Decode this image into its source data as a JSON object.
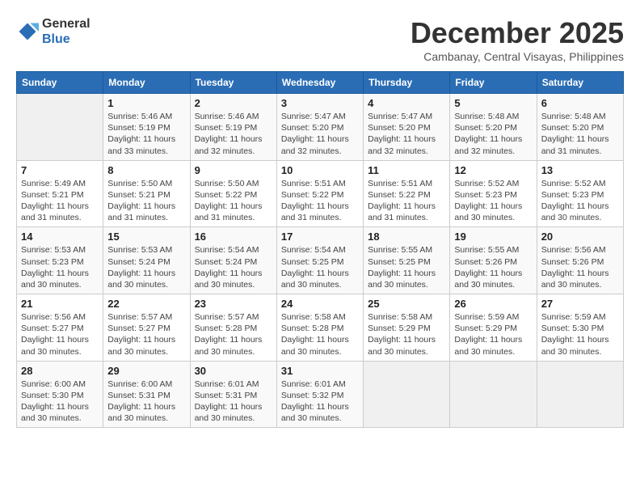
{
  "header": {
    "logo_line1": "General",
    "logo_line2": "Blue",
    "month": "December 2025",
    "location": "Cambanay, Central Visayas, Philippines"
  },
  "weekdays": [
    "Sunday",
    "Monday",
    "Tuesday",
    "Wednesday",
    "Thursday",
    "Friday",
    "Saturday"
  ],
  "weeks": [
    [
      {
        "day": "",
        "empty": true
      },
      {
        "day": "1",
        "sunrise": "5:46 AM",
        "sunset": "5:19 PM",
        "daylight": "11 hours and 33 minutes."
      },
      {
        "day": "2",
        "sunrise": "5:46 AM",
        "sunset": "5:19 PM",
        "daylight": "11 hours and 32 minutes."
      },
      {
        "day": "3",
        "sunrise": "5:47 AM",
        "sunset": "5:20 PM",
        "daylight": "11 hours and 32 minutes."
      },
      {
        "day": "4",
        "sunrise": "5:47 AM",
        "sunset": "5:20 PM",
        "daylight": "11 hours and 32 minutes."
      },
      {
        "day": "5",
        "sunrise": "5:48 AM",
        "sunset": "5:20 PM",
        "daylight": "11 hours and 32 minutes."
      },
      {
        "day": "6",
        "sunrise": "5:48 AM",
        "sunset": "5:20 PM",
        "daylight": "11 hours and 31 minutes."
      }
    ],
    [
      {
        "day": "7",
        "sunrise": "5:49 AM",
        "sunset": "5:21 PM",
        "daylight": "11 hours and 31 minutes."
      },
      {
        "day": "8",
        "sunrise": "5:50 AM",
        "sunset": "5:21 PM",
        "daylight": "11 hours and 31 minutes."
      },
      {
        "day": "9",
        "sunrise": "5:50 AM",
        "sunset": "5:22 PM",
        "daylight": "11 hours and 31 minutes."
      },
      {
        "day": "10",
        "sunrise": "5:51 AM",
        "sunset": "5:22 PM",
        "daylight": "11 hours and 31 minutes."
      },
      {
        "day": "11",
        "sunrise": "5:51 AM",
        "sunset": "5:22 PM",
        "daylight": "11 hours and 31 minutes."
      },
      {
        "day": "12",
        "sunrise": "5:52 AM",
        "sunset": "5:23 PM",
        "daylight": "11 hours and 30 minutes."
      },
      {
        "day": "13",
        "sunrise": "5:52 AM",
        "sunset": "5:23 PM",
        "daylight": "11 hours and 30 minutes."
      }
    ],
    [
      {
        "day": "14",
        "sunrise": "5:53 AM",
        "sunset": "5:23 PM",
        "daylight": "11 hours and 30 minutes."
      },
      {
        "day": "15",
        "sunrise": "5:53 AM",
        "sunset": "5:24 PM",
        "daylight": "11 hours and 30 minutes."
      },
      {
        "day": "16",
        "sunrise": "5:54 AM",
        "sunset": "5:24 PM",
        "daylight": "11 hours and 30 minutes."
      },
      {
        "day": "17",
        "sunrise": "5:54 AM",
        "sunset": "5:25 PM",
        "daylight": "11 hours and 30 minutes."
      },
      {
        "day": "18",
        "sunrise": "5:55 AM",
        "sunset": "5:25 PM",
        "daylight": "11 hours and 30 minutes."
      },
      {
        "day": "19",
        "sunrise": "5:55 AM",
        "sunset": "5:26 PM",
        "daylight": "11 hours and 30 minutes."
      },
      {
        "day": "20",
        "sunrise": "5:56 AM",
        "sunset": "5:26 PM",
        "daylight": "11 hours and 30 minutes."
      }
    ],
    [
      {
        "day": "21",
        "sunrise": "5:56 AM",
        "sunset": "5:27 PM",
        "daylight": "11 hours and 30 minutes."
      },
      {
        "day": "22",
        "sunrise": "5:57 AM",
        "sunset": "5:27 PM",
        "daylight": "11 hours and 30 minutes."
      },
      {
        "day": "23",
        "sunrise": "5:57 AM",
        "sunset": "5:28 PM",
        "daylight": "11 hours and 30 minutes."
      },
      {
        "day": "24",
        "sunrise": "5:58 AM",
        "sunset": "5:28 PM",
        "daylight": "11 hours and 30 minutes."
      },
      {
        "day": "25",
        "sunrise": "5:58 AM",
        "sunset": "5:29 PM",
        "daylight": "11 hours and 30 minutes."
      },
      {
        "day": "26",
        "sunrise": "5:59 AM",
        "sunset": "5:29 PM",
        "daylight": "11 hours and 30 minutes."
      },
      {
        "day": "27",
        "sunrise": "5:59 AM",
        "sunset": "5:30 PM",
        "daylight": "11 hours and 30 minutes."
      }
    ],
    [
      {
        "day": "28",
        "sunrise": "6:00 AM",
        "sunset": "5:30 PM",
        "daylight": "11 hours and 30 minutes."
      },
      {
        "day": "29",
        "sunrise": "6:00 AM",
        "sunset": "5:31 PM",
        "daylight": "11 hours and 30 minutes."
      },
      {
        "day": "30",
        "sunrise": "6:01 AM",
        "sunset": "5:31 PM",
        "daylight": "11 hours and 30 minutes."
      },
      {
        "day": "31",
        "sunrise": "6:01 AM",
        "sunset": "5:32 PM",
        "daylight": "11 hours and 30 minutes."
      },
      {
        "day": "",
        "empty": true
      },
      {
        "day": "",
        "empty": true
      },
      {
        "day": "",
        "empty": true
      }
    ]
  ]
}
